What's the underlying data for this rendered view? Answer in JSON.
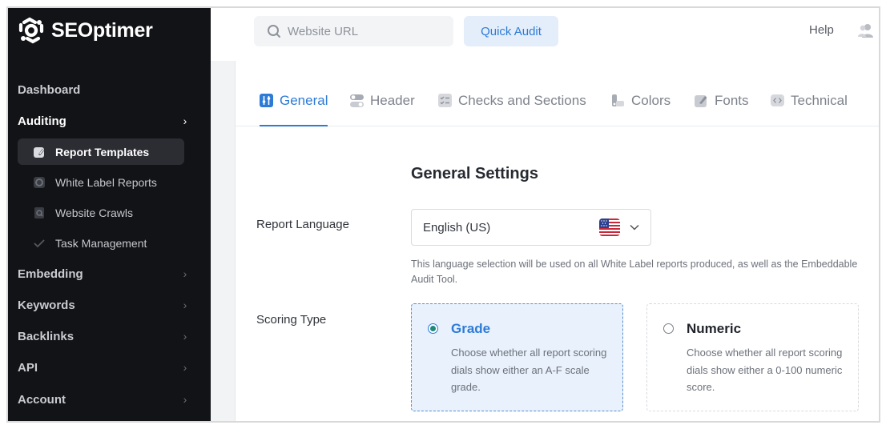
{
  "brand": {
    "name": "SEOptimer"
  },
  "sidebar": {
    "items": [
      {
        "label": "Dashboard",
        "active": false,
        "chevron": false
      },
      {
        "label": "Auditing",
        "active": true,
        "chevron": true
      },
      {
        "label": "Embedding",
        "active": false,
        "chevron": true
      },
      {
        "label": "Keywords",
        "active": false,
        "chevron": true
      },
      {
        "label": "Backlinks",
        "active": false,
        "chevron": true
      },
      {
        "label": "API",
        "active": false,
        "chevron": true
      },
      {
        "label": "Account",
        "active": false,
        "chevron": true
      }
    ],
    "sub_items": [
      {
        "label": "Report Templates",
        "icon": "template-icon",
        "active": true
      },
      {
        "label": "White Label Reports",
        "icon": "report-icon",
        "active": false
      },
      {
        "label": "Website Crawls",
        "icon": "crawl-icon",
        "active": false
      },
      {
        "label": "Task Management",
        "icon": "check-icon",
        "active": false
      }
    ],
    "chevron_glyph": "›"
  },
  "topbar": {
    "search_placeholder": "Website URL",
    "audit_button": "Quick Audit",
    "help": "Help"
  },
  "tabs": [
    {
      "label": "General",
      "icon": "sliders-icon",
      "active": true
    },
    {
      "label": "Header",
      "icon": "toggle-icon",
      "active": false
    },
    {
      "label": "Checks and Sections",
      "icon": "checklist-icon",
      "active": false
    },
    {
      "label": "Colors",
      "icon": "palette-icon",
      "active": false
    },
    {
      "label": "Fonts",
      "icon": "brush-icon",
      "active": false
    },
    {
      "label": "Technical",
      "icon": "code-icon",
      "active": false
    }
  ],
  "general": {
    "title": "General Settings",
    "language_label": "Report Language",
    "language_value": "English (US)",
    "language_flag": "us-flag-icon",
    "language_help": "This language selection will be used on all White Label reports produced, as well as the Embeddable Audit Tool.",
    "scoring_label": "Scoring Type",
    "scoring_options": [
      {
        "title": "Grade",
        "desc": "Choose whether all report scoring dials show either an A-F scale grade.",
        "selected": true
      },
      {
        "title": "Numeric",
        "desc": "Choose whether all report scoring dials show either a 0-100 numeric score.",
        "selected": false
      }
    ]
  },
  "colors": {
    "sidebar_bg": "#121316",
    "accent": "#2d7bd6",
    "selected_bg": "#e8f1fc",
    "radio_dot": "#1f8a7a"
  }
}
